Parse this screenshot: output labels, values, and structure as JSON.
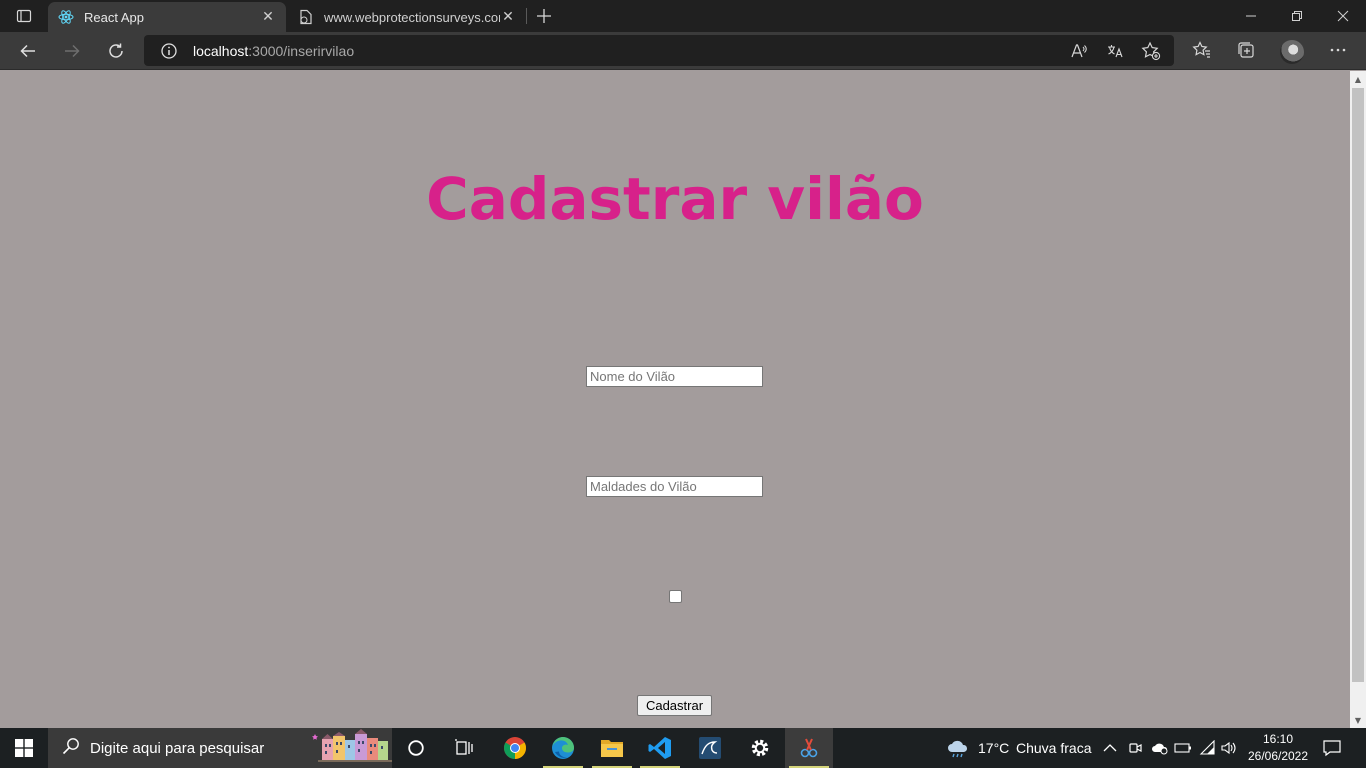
{
  "browser": {
    "tabs": [
      {
        "title": "React App",
        "favicon": "react-icon",
        "active": true
      },
      {
        "title": "www.webprotectionsurveys.com",
        "favicon": "page-icon",
        "active": false
      }
    ],
    "address": {
      "host": "localhost",
      "path": ":3000/inserirvilao"
    }
  },
  "page": {
    "heading": "Cadastrar vilão",
    "name_placeholder": "Nome do Vilão",
    "evil_placeholder": "Maldades do Vilão",
    "submit_label": "Cadastrar"
  },
  "taskbar": {
    "search_placeholder": "Digite aqui para pesquisar",
    "weather_temp": "17°C",
    "weather_desc": "Chuva fraca",
    "time": "16:10",
    "date": "26/06/2022"
  },
  "colors": {
    "heading": "#d7218a",
    "page_bg": "#a39c9c"
  }
}
